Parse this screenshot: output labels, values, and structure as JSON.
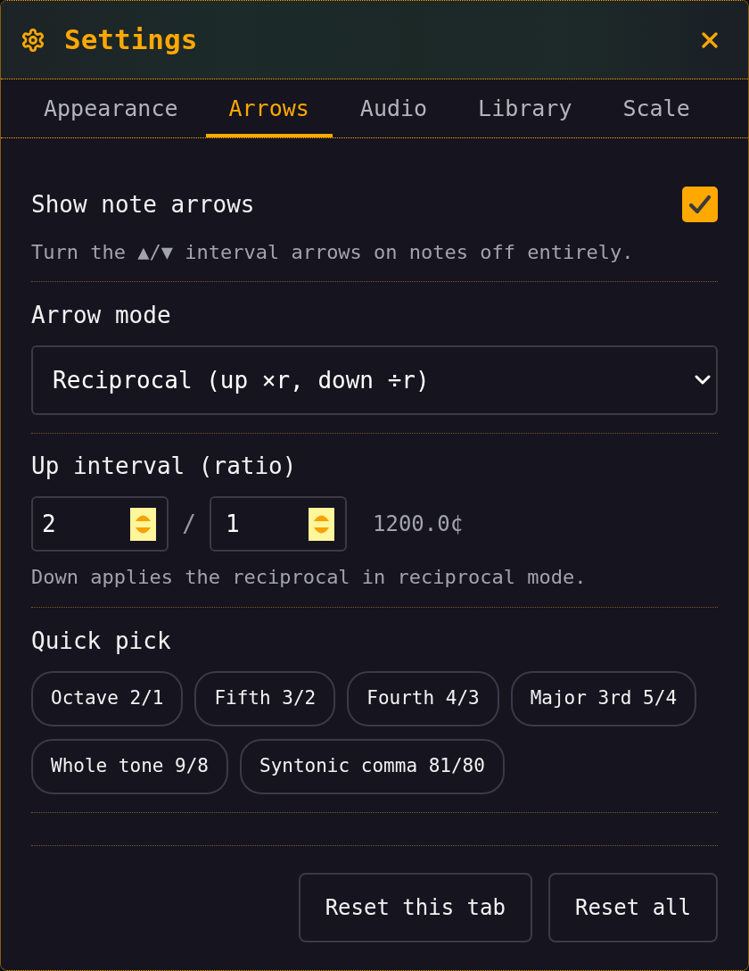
{
  "header": {
    "title": "Settings"
  },
  "tabs": [
    {
      "label": "Appearance",
      "selected": false
    },
    {
      "label": "Arrows",
      "selected": true
    },
    {
      "label": "Audio",
      "selected": false
    },
    {
      "label": "Library",
      "selected": false
    },
    {
      "label": "Scale",
      "selected": false
    }
  ],
  "sections": [
    {
      "kind": "checkbox",
      "label": "Show note arrows",
      "checked": true,
      "description": "Turn the ▲/▼ interval arrows on notes off entirely."
    },
    {
      "kind": "select",
      "label": "Arrow mode",
      "value": "Reciprocal (up ×r, down ÷r)"
    },
    {
      "kind": "ratio",
      "label": "Up interval (ratio)",
      "numerator": "2",
      "separator": "/",
      "denominator": "1",
      "reading": "1200.0¢",
      "description": "Down applies the reciprocal in reciprocal mode."
    },
    {
      "kind": "chips",
      "label": "Quick pick",
      "chips": [
        "Octave 2/1",
        "Fifth 3/2",
        "Fourth 4/3",
        "Major 3rd 5/4",
        "Whole tone 9/8",
        "Syntonic comma 81/80"
      ]
    }
  ],
  "footer_buttons": [
    "Reset this tab",
    "Reset all"
  ]
}
